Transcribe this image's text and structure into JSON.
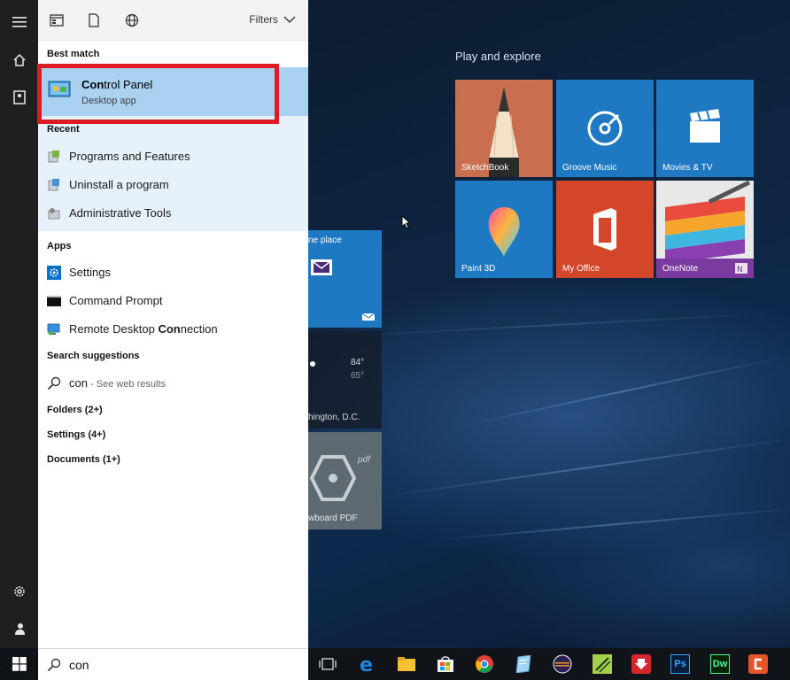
{
  "rail": {
    "icons": [
      "hamburger-icon",
      "home-icon",
      "notebook-icon",
      "settings-icon",
      "feedback-icon"
    ]
  },
  "toolbar": {
    "icons": [
      "apps-filter-icon",
      "documents-filter-icon",
      "web-filter-icon"
    ],
    "filters_label": "Filters"
  },
  "best_match": {
    "title": "Best match",
    "name_bold": "Con",
    "name_rest": "trol Panel",
    "subtitle": "Desktop app"
  },
  "recent": {
    "title": "Recent",
    "items": [
      {
        "label": "Programs and Features",
        "icon": "programs-features-icon"
      },
      {
        "label": "Uninstall a program",
        "icon": "uninstall-icon"
      },
      {
        "label": "Administrative Tools",
        "icon": "admin-tools-icon"
      }
    ]
  },
  "apps": {
    "title": "Apps",
    "items": [
      {
        "label": "Settings",
        "icon": "settings-gear-icon"
      },
      {
        "label": "Command Prompt",
        "icon": "command-prompt-icon"
      },
      {
        "label_pre": "Remote Desktop ",
        "label_bold": "Con",
        "label_post": "nection",
        "icon": "remote-desktop-icon"
      }
    ]
  },
  "suggestions": {
    "title": "Search suggestions",
    "query": "con",
    "hint": " - See web results"
  },
  "categories": {
    "folders": "Folders (2+)",
    "settings": "Settings (4+)",
    "documents": "Documents (1+)"
  },
  "search": {
    "value": "con"
  },
  "play_explore": {
    "title": "Play and explore",
    "tiles": [
      {
        "label": "SketchBook",
        "color": "#c96e4e"
      },
      {
        "label": "Groove Music",
        "color": "#1e78c2"
      },
      {
        "label": "Movies & TV",
        "color": "#1e78c2"
      },
      {
        "label": "Paint 3D",
        "color": "#1e78c2"
      },
      {
        "label": "My Office",
        "color": "#d4462a"
      },
      {
        "label": "OneNote",
        "color": "#7a3aa0"
      }
    ]
  },
  "partial_tiles": {
    "mail_text": "ne place",
    "weather_high": "84°",
    "weather_low": "65°",
    "weather_city": "hington, D.C.",
    "pdf_label": "wboard PDF"
  },
  "taskbar": {
    "apps": [
      "task-view-icon",
      "edge-icon",
      "file-explorer-icon",
      "store-icon",
      "chrome-icon",
      "notepad-icon",
      "eclipse-icon",
      "tool-icon",
      "download-icon",
      "photoshop-icon",
      "dreamweaver-icon",
      "camtasia-icon"
    ],
    "ps_label": "Ps",
    "dw_label": "Dw"
  }
}
